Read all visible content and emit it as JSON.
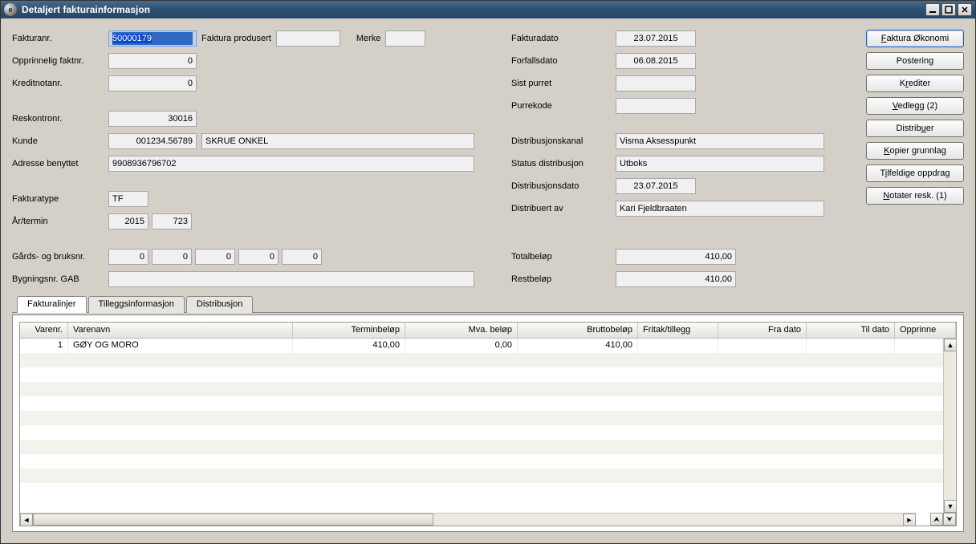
{
  "window": {
    "title": "Detaljert fakturainformasjon"
  },
  "left": {
    "fakturanr_label": "Fakturanr.",
    "fakturanr": "50000179",
    "fakturaprodusert_label": "Faktura produsert",
    "fakturaprodusert": "",
    "merke_label": "Merke",
    "merke": "",
    "opprinnelig_label": "Opprinnelig faktnr.",
    "opprinnelig": "0",
    "kreditnotanr_label": "Kreditnotanr.",
    "kreditnotanr": "0",
    "reskontronr_label": "Reskontronr.",
    "reskontronr": "30016",
    "kunde_label": "Kunde",
    "kunde_nr": "001234.56789",
    "kunde_navn": "SKRUE ONKEL",
    "adresse_label": "Adresse benyttet",
    "adresse": "9908936796702",
    "fakturatype_label": "Fakturatype",
    "fakturatype": "TF",
    "artermin_label": "År/termin",
    "ar": "2015",
    "termin": "723",
    "gardsbruk_label": "Gårds- og bruksnr.",
    "g1": "0",
    "g2": "0",
    "g3": "0",
    "g4": "0",
    "g5": "0",
    "bygningsnr_label": "Bygningsnr. GAB",
    "bygningsnr": ""
  },
  "mid": {
    "fakturadato_label": "Fakturadato",
    "fakturadato": "23.07.2015",
    "forfallsdato_label": "Forfallsdato",
    "forfallsdato": "06.08.2015",
    "sistpurret_label": "Sist purret",
    "sistpurret": "",
    "purrekode_label": "Purrekode",
    "purrekode": "",
    "distkanal_label": "Distribusjonskanal",
    "distkanal": "Visma Aksesspunkt",
    "statusdist_label": "Status distribusjon",
    "statusdist": "Utboks",
    "distdato_label": "Distribusjonsdato",
    "distdato": "23.07.2015",
    "distav_label": "Distribuert av",
    "distav": "Kari Fjeldbraaten",
    "totalbelop_label": "Totalbeløp",
    "totalbelop": "410,00",
    "restbelop_label": "Restbeløp",
    "restbelop": "410,00"
  },
  "buttons": {
    "okonomi": "Faktura Økonomi",
    "postering": "Postering",
    "krediter": "Krediter",
    "vedlegg": "Vedlegg (2)",
    "distribuer": "Distribuer",
    "kopier": "Kopier grunnlag",
    "tilfeldige": "Tilfeldige oppdrag",
    "notater": "Notater resk. (1)"
  },
  "tabs": {
    "fakturalinjer": "Fakturalinjer",
    "tillegg": "Tilleggsinformasjon",
    "distribusjon": "Distribusjon"
  },
  "grid": {
    "headers": {
      "varenr": "Varenr.",
      "varenavn": "Varenavn",
      "terminbelop": "Terminbeløp",
      "mvabelop": "Mva. beløp",
      "bruttobelop": "Bruttobeløp",
      "fritak": "Fritak/tillegg",
      "fradato": "Fra dato",
      "tildato": "Til dato",
      "opprinne": "Opprinne"
    },
    "rows": [
      {
        "varenr": "1",
        "varenavn": "GØY OG MORO",
        "terminbelop": "410,00",
        "mvabelop": "0,00",
        "bruttobelop": "410,00",
        "fritak": "",
        "fradato": "",
        "tildato": "",
        "opprinne": ""
      }
    ]
  }
}
